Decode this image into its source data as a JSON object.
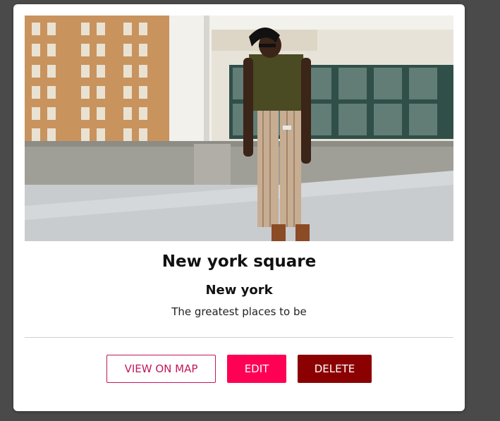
{
  "card": {
    "image_alt": "Man in olive top and striped trousers standing on a rooftop in front of city buildings",
    "title": "New york square",
    "city": "New york",
    "description": "The greatest places to be"
  },
  "actions": {
    "view_on_map_label": "VIEW ON MAP",
    "edit_label": "EDIT",
    "delete_label": "DELETE"
  },
  "colors": {
    "page_background": "#4a4a4a",
    "card_background": "#ffffff",
    "view_on_map": "#c2185b",
    "edit": "#ff0055",
    "delete": "#8b0000"
  }
}
